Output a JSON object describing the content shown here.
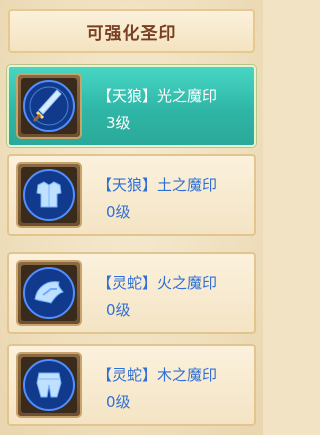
{
  "header": {
    "title": "可强化圣印"
  },
  "seals": [
    {
      "name": "【天狼】光之魔印",
      "level": "3级",
      "icon": "sword-icon",
      "selected": true
    },
    {
      "name": "【天狼】土之魔印",
      "level": "0级",
      "icon": "armor-icon",
      "selected": false
    },
    {
      "name": "【灵蛇】火之魔印",
      "level": "0级",
      "icon": "helmet-icon",
      "selected": false
    },
    {
      "name": "【灵蛇】木之魔印",
      "level": "0级",
      "icon": "leggings-icon",
      "selected": false
    }
  ],
  "colors": {
    "selected_bg": "#2fb6a6",
    "text_blue": "#2f6fd6",
    "header_text": "#7a3f22"
  }
}
